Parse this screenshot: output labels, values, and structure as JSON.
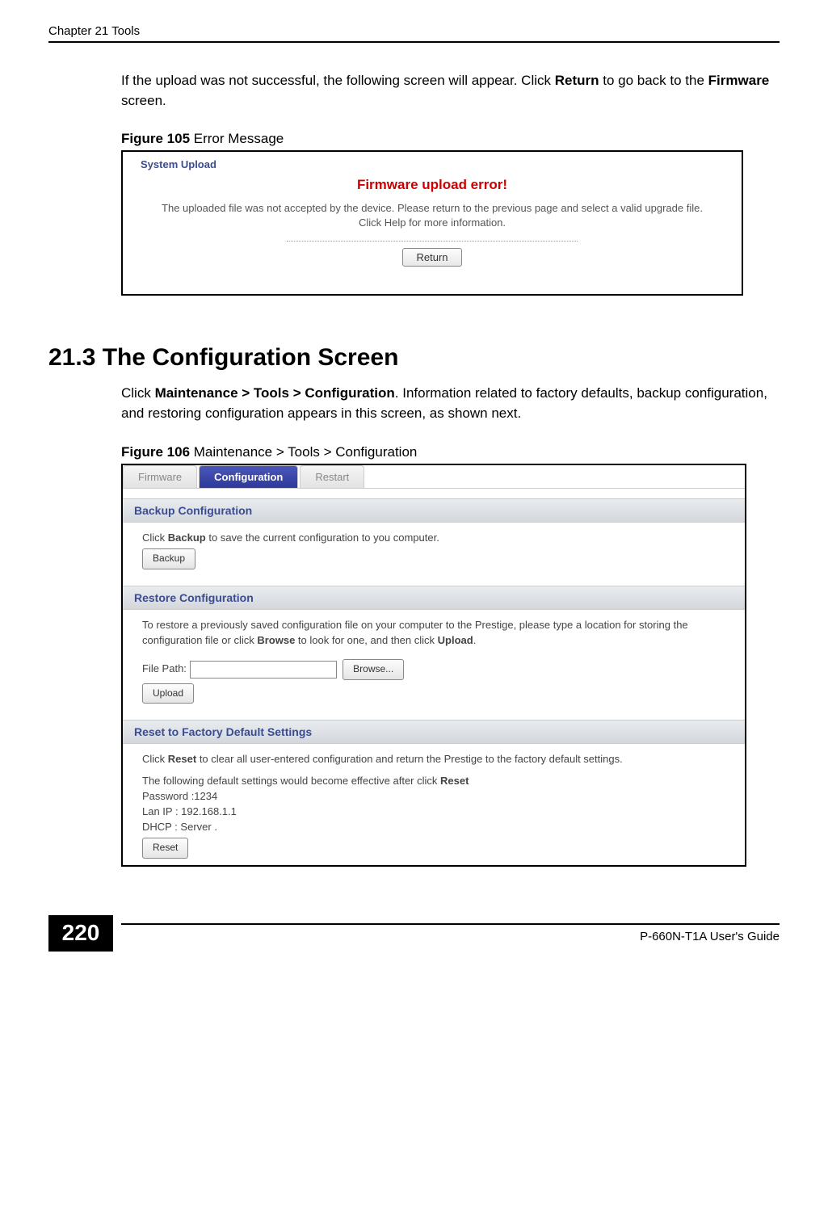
{
  "header": {
    "chapter": "Chapter 21 Tools"
  },
  "intro_paragraph": "If the upload was not successful, the following screen will appear. Click Return to go back to the Firmware screen.",
  "figure105": {
    "label_bold": "Figure 105",
    "label_rest": "   Error Message",
    "title": "System Upload",
    "error_heading": "Firmware upload error!",
    "message": "The uploaded file was not accepted by the device. Please return to the previous page and select a valid upgrade file. Click Help for more information.",
    "return_button": "Return"
  },
  "section": {
    "heading": "21.3  The Configuration Screen",
    "paragraph": "Click Maintenance > Tools > Configuration. Information related to factory defaults, backup configuration, and restoring configuration appears in this screen, as shown next."
  },
  "figure106": {
    "label_bold": "Figure 106",
    "label_rest": "   Maintenance > Tools > Configuration",
    "tabs": {
      "firmware": "Firmware",
      "configuration": "Configuration",
      "restart": "Restart"
    },
    "backup": {
      "heading": "Backup Configuration",
      "text": "Click Backup to save the current configuration to you computer.",
      "button": "Backup"
    },
    "restore": {
      "heading": "Restore Configuration",
      "text": "To restore a previously saved configuration file on your computer to the Prestige, please type a location for storing the configuration file or click Browse to look for one, and then click Upload.",
      "file_label": "File Path:",
      "browse_button": "Browse...",
      "upload_button": "Upload"
    },
    "reset": {
      "heading": "Reset to Factory Default Settings",
      "text": "Click Reset to clear all user-entered configuration and return the Prestige to the factory default settings.",
      "defaults_intro": "The following default settings would become effective after click Reset",
      "password": "Password :1234",
      "lanip": "Lan IP : 192.168.1.1",
      "dhcp": "DHCP : Server .",
      "button": "Reset"
    }
  },
  "footer": {
    "page_number": "220",
    "guide": "P-660N-T1A User's Guide"
  }
}
